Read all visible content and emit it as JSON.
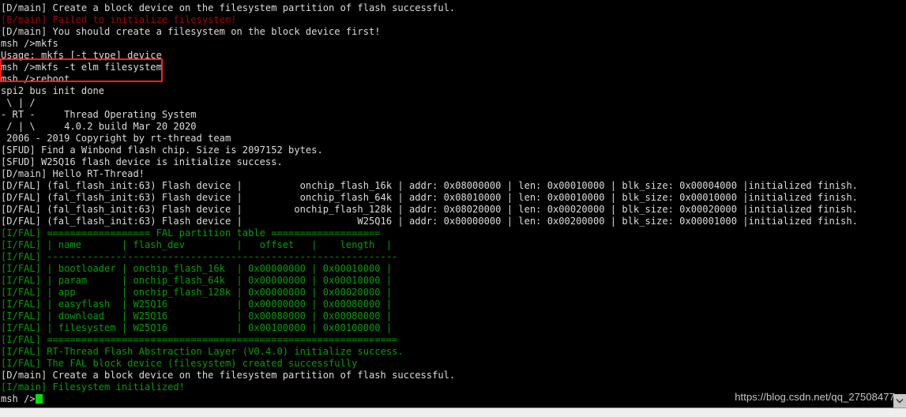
{
  "terminal": {
    "background_color": "#000000",
    "default_text_color": "#dcdcdc",
    "error_color": "#aa0000",
    "info_color": "#00a000",
    "highlight_box_color": "#ff2020",
    "cursor_color": "#00e000",
    "lines": [
      {
        "text": "[D/main] Create a block device on the filesystem partition of flash successful.",
        "color": "white"
      },
      {
        "text": "[E/main] Failed to initialize filesystem!",
        "color": "red"
      },
      {
        "text": "[D/main] You should create a filesystem on the block device first!",
        "color": "white"
      },
      {
        "text": "msh />mkfs",
        "color": "white"
      },
      {
        "text": "Usage: mkfs [-t type] device",
        "color": "white"
      },
      {
        "text": "msh />mkfs -t elm filesystem",
        "color": "white"
      },
      {
        "text": "msh />reboot",
        "color": "white"
      },
      {
        "text": "spi2 bus init done",
        "color": "white"
      },
      {
        "text": " \\ | /",
        "color": "white"
      },
      {
        "text": "- RT -     Thread Operating System",
        "color": "white"
      },
      {
        "text": " / | \\     4.0.2 build Mar 20 2020",
        "color": "white"
      },
      {
        "text": " 2006 - 2019 Copyright by rt-thread team",
        "color": "white"
      },
      {
        "text": "[SFUD] Find a Winbond flash chip. Size is 2097152 bytes.",
        "color": "white"
      },
      {
        "text": "[SFUD] W25Q16 flash device is initialize success.",
        "color": "white"
      },
      {
        "text": "[D/main] Hello RT-Thread!",
        "color": "white"
      },
      {
        "text": "[D/FAL] (fal_flash_init:63) Flash device |          onchip_flash_16k | addr: 0x08000000 | len: 0x00010000 | blk_size: 0x00004000 |initialized finish.",
        "color": "white"
      },
      {
        "text": "[D/FAL] (fal_flash_init:63) Flash device |          onchip_flash_64k | addr: 0x08010000 | len: 0x00010000 | blk_size: 0x00010000 |initialized finish.",
        "color": "white"
      },
      {
        "text": "[D/FAL] (fal_flash_init:63) Flash device |         onchip_flash_128k | addr: 0x08020000 | len: 0x00020000 | blk_size: 0x00020000 |initialized finish.",
        "color": "white"
      },
      {
        "text": "[D/FAL] (fal_flash_init:63) Flash device |                    W25Q16 | addr: 0x00000000 | len: 0x00200000 | blk_size: 0x00001000 |initialized finish.",
        "color": "white"
      },
      {
        "text": "[I/FAL] ================== FAL partition table ===================",
        "color": "green"
      },
      {
        "text": "[I/FAL] | name       | flash_dev         |   offset   |    length  |",
        "color": "green"
      },
      {
        "text": "[I/FAL] -------------------------------------------------------------",
        "color": "green"
      },
      {
        "text": "[I/FAL] | bootloader | onchip_flash_16k  | 0x00000000 | 0x00010000 |",
        "color": "green"
      },
      {
        "text": "[I/FAL] | param      | onchip_flash_64k  | 0x00000000 | 0x00010000 |",
        "color": "green"
      },
      {
        "text": "[I/FAL] | app        | onchip_flash_128k | 0x00000000 | 0x00020000 |",
        "color": "green"
      },
      {
        "text": "[I/FAL] | easyflash  | W25Q16            | 0x00000000 | 0x00080000 |",
        "color": "green"
      },
      {
        "text": "[I/FAL] | download   | W25Q16            | 0x00080000 | 0x00080000 |",
        "color": "green"
      },
      {
        "text": "[I/FAL] | filesystem | W25Q16            | 0x00100000 | 0x00100000 |",
        "color": "green"
      },
      {
        "text": "[I/FAL] =============================================================",
        "color": "green"
      },
      {
        "text": "[I/FAL] RT-Thread Flash Abstraction Layer (V0.4.0) initialize success.",
        "color": "green"
      },
      {
        "text": "[I/FAL] The FAL block device (filesystem) created successfully",
        "color": "green"
      },
      {
        "text": "[D/main] Create a block device on the filesystem partition of flash successful.",
        "color": "white"
      },
      {
        "text": "[I/main] Filesystem initialized!",
        "color": "green"
      }
    ],
    "prompt": {
      "text": "msh />",
      "cursor": "block-cursor"
    }
  },
  "watermark": {
    "text": "https://blog.csdn.net/qq_27508477"
  },
  "scrollbar": {
    "down_arrow_icon": "chevron-down-icon"
  },
  "highlight": {
    "label": "red-highlight-box",
    "covers_lines": [
      "msh />mkfs -t elm filesystem",
      "msh />reboot"
    ]
  }
}
